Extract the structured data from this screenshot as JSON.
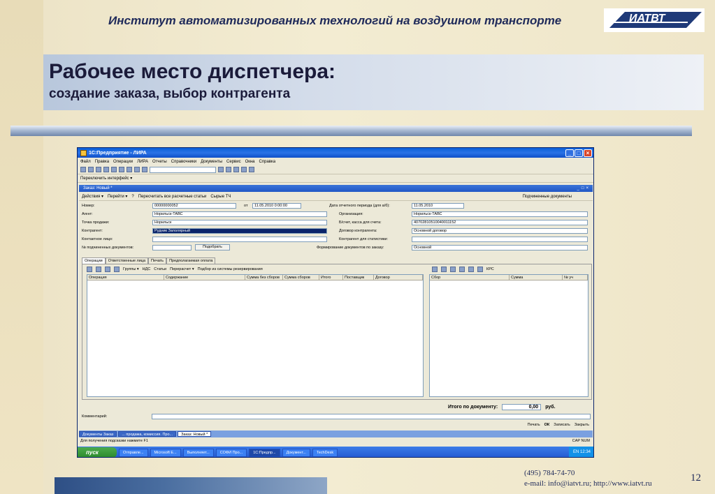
{
  "slide": {
    "header_title": "Институт автоматизированных технологий на воздушном транспорте",
    "logo_text": "ИАТВТ",
    "title_main": "Рабочее место диспетчера:",
    "title_sub": "создание заказа, выбор контрагента",
    "contact_phone": "(495) 784-74-70",
    "contact_line": "e-mail: info@iatvt.ru; http://www.iatvt.ru",
    "page_number": "12"
  },
  "window": {
    "title": "1С:Предприятие - ЛИРА",
    "menu": [
      "Файл",
      "Правка",
      "Операции",
      "ЛИРА",
      "Отчеты",
      "Справочники",
      "Документы",
      "Сервис",
      "Окна",
      "Справка"
    ],
    "interface_switch": "Переключить интерфейс ▾"
  },
  "doc": {
    "title": "Заказ: Новый *",
    "actions_label": "Действия ▾",
    "goto_label": "Перейти ▾",
    "help_label": "?",
    "recalc_label": "Пересчитать все расчетные статьи",
    "raw_label": "Сырые ТЧ",
    "subordinate_docs": "Подчиненные документы",
    "number_label": "Номер:",
    "number_value": "00000000052",
    "from_label": "от",
    "date_value": "11.05.2010  0:00:00",
    "period_label": "Дата отчетного периода (для а/б):",
    "period_value": "11.05.2010",
    "agent_label": "Агент:",
    "agent_value": "Норильск-ТАВС",
    "org_label": "Организация:",
    "org_value": "Норильск-ТАВС",
    "point_label": "Точка продажи:",
    "point_value": "Норильск",
    "account_label": "Б/счет, касса для счета:",
    "account_value": "40702810510040011152",
    "contractor_label": "Контрагент:",
    "contractor_value": "Рудник Заполярный",
    "contract_label": "Договор контрагента:",
    "contract_value": "Основной договор",
    "contact_label": "Контактное лицо:",
    "stat_label": "Контрагент для статистики:",
    "subdocs_label": "№ подчиненных документов:",
    "pick_label": "Подобрать",
    "forming_label": "Формирование документов по заказу:",
    "forming_value": "Основной",
    "tabs": [
      "Операции",
      "Ответственные лица",
      "Печать",
      "Предполагаемая оплата"
    ],
    "grid_toolbar": [
      "Группы ▾",
      "НДС",
      "Статьи",
      "Перерасчет ▾",
      "Подбор из системы резервирования"
    ],
    "left_columns": [
      "Операция",
      "Содержание",
      "Сумма без сборов",
      "Сумма сборов",
      "Итого",
      "Поставщик",
      "Договор"
    ],
    "right_toolbar_label": "КРС",
    "right_columns": [
      "Сбор",
      "Сумма",
      "№ уч"
    ],
    "total_label": "Итого по документу:",
    "total_value": "0,00",
    "currency": "руб.",
    "comment_label": "Комментарий:",
    "buttons": [
      "Печать",
      "ОК",
      "Записать",
      "Закрыть"
    ]
  },
  "wintabs": [
    "Документы Заказ",
    "... продажа, комиссия. Про...",
    "Заказ: Новый *"
  ],
  "status": {
    "hint": "Для получения подсказки нажмите F1",
    "caps": "CAP",
    "num": "NUM"
  },
  "taskbar": {
    "start": "пуск",
    "tasks": [
      "Отправле...",
      "Microsoft E...",
      "Выполняет...",
      "СОФИ Про...",
      "1С:Предпр...",
      "Документ...",
      "TechDesk"
    ],
    "lang": "EN",
    "clock": "12:34"
  }
}
